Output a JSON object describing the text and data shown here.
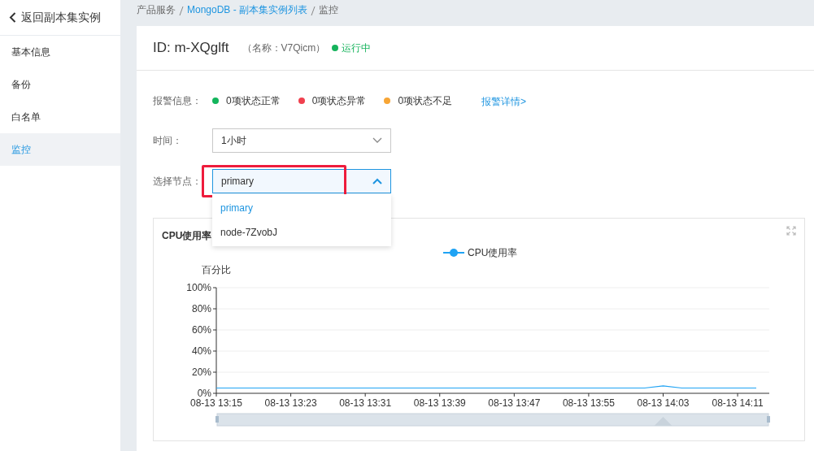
{
  "sidebar": {
    "back_link": "返回副本集实例",
    "items": [
      {
        "label": "基本信息",
        "selected": false
      },
      {
        "label": "备份",
        "selected": false
      },
      {
        "label": "白名单",
        "selected": false
      },
      {
        "label": "监控",
        "selected": true
      }
    ]
  },
  "breadcrumb": [
    {
      "label": "产品服务",
      "link": false
    },
    {
      "label": "MongoDB - 副本集实例列表",
      "link": true
    },
    {
      "label": "监控",
      "link": false
    }
  ],
  "header": {
    "id": "ID: m-XQglft",
    "name": "（名称：V7Qicm）",
    "status": {
      "label": "运行中",
      "color": "#16b35c"
    }
  },
  "alerts": {
    "label": "报警信息：",
    "items": [
      {
        "text": "0项状态正常",
        "color": "#13b55c"
      },
      {
        "text": "0项状态异常",
        "color": "#f0404e"
      },
      {
        "text": "0项状态不足",
        "color": "#f7a535"
      }
    ],
    "link": "报警详情>"
  },
  "time_filter": {
    "label": "时间：",
    "value": "1小时"
  },
  "node_filter": {
    "label": "选择节点：",
    "value": "primary",
    "expanded": true,
    "highlighted": true,
    "options": [
      {
        "label": "primary",
        "selected": true
      },
      {
        "label": "node-7ZvobJ",
        "selected": false
      }
    ]
  },
  "chart_panel": {
    "title": "CPU使用率",
    "chart_data": {
      "type": "line",
      "ylabel": "百分比",
      "grid": true,
      "categories": [
        "08-13 13:15",
        null,
        null,
        null,
        "08-13 13:23",
        null,
        null,
        null,
        "08-13 13:31",
        null,
        null,
        null,
        "08-13 13:39",
        null,
        null,
        null,
        "08-13 13:47",
        null,
        null,
        null,
        "08-13 13:55",
        null,
        null,
        null,
        "08-13 14:03",
        null,
        null,
        null,
        "08-13 14:11",
        null
      ],
      "ylim": [
        0,
        100
      ],
      "yticks": [
        {
          "value": 0,
          "label": "0%"
        },
        {
          "value": 20,
          "label": "20%"
        },
        {
          "value": 40,
          "label": "40%"
        },
        {
          "value": 60,
          "label": "60%"
        },
        {
          "value": 80,
          "label": "80%"
        },
        {
          "value": 100,
          "label": "100%"
        }
      ],
      "series": [
        {
          "name": "CPU使用率",
          "color": "#1fa3f4",
          "values": [
            5,
            5,
            5,
            5,
            5,
            5,
            5,
            5,
            5,
            5,
            5,
            5,
            5,
            5,
            5,
            5,
            5,
            5,
            5,
            5,
            5,
            5,
            5,
            5,
            7,
            5,
            5,
            5,
            5,
            5
          ]
        }
      ]
    }
  }
}
